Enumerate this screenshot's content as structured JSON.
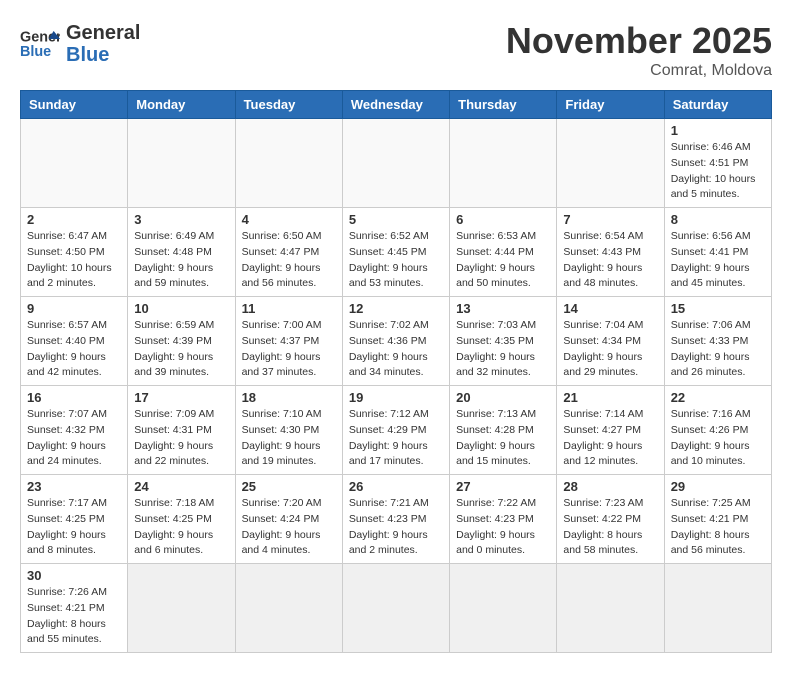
{
  "header": {
    "logo_general": "General",
    "logo_blue": "Blue",
    "month_title": "November 2025",
    "location": "Comrat, Moldova"
  },
  "weekdays": [
    "Sunday",
    "Monday",
    "Tuesday",
    "Wednesday",
    "Thursday",
    "Friday",
    "Saturday"
  ],
  "weeks": [
    [
      {
        "day": "",
        "info": ""
      },
      {
        "day": "",
        "info": ""
      },
      {
        "day": "",
        "info": ""
      },
      {
        "day": "",
        "info": ""
      },
      {
        "day": "",
        "info": ""
      },
      {
        "day": "",
        "info": ""
      },
      {
        "day": "1",
        "info": "Sunrise: 6:46 AM\nSunset: 4:51 PM\nDaylight: 10 hours and 5 minutes."
      }
    ],
    [
      {
        "day": "2",
        "info": "Sunrise: 6:47 AM\nSunset: 4:50 PM\nDaylight: 10 hours and 2 minutes."
      },
      {
        "day": "3",
        "info": "Sunrise: 6:49 AM\nSunset: 4:48 PM\nDaylight: 9 hours and 59 minutes."
      },
      {
        "day": "4",
        "info": "Sunrise: 6:50 AM\nSunset: 4:47 PM\nDaylight: 9 hours and 56 minutes."
      },
      {
        "day": "5",
        "info": "Sunrise: 6:52 AM\nSunset: 4:45 PM\nDaylight: 9 hours and 53 minutes."
      },
      {
        "day": "6",
        "info": "Sunrise: 6:53 AM\nSunset: 4:44 PM\nDaylight: 9 hours and 50 minutes."
      },
      {
        "day": "7",
        "info": "Sunrise: 6:54 AM\nSunset: 4:43 PM\nDaylight: 9 hours and 48 minutes."
      },
      {
        "day": "8",
        "info": "Sunrise: 6:56 AM\nSunset: 4:41 PM\nDaylight: 9 hours and 45 minutes."
      }
    ],
    [
      {
        "day": "9",
        "info": "Sunrise: 6:57 AM\nSunset: 4:40 PM\nDaylight: 9 hours and 42 minutes."
      },
      {
        "day": "10",
        "info": "Sunrise: 6:59 AM\nSunset: 4:39 PM\nDaylight: 9 hours and 39 minutes."
      },
      {
        "day": "11",
        "info": "Sunrise: 7:00 AM\nSunset: 4:37 PM\nDaylight: 9 hours and 37 minutes."
      },
      {
        "day": "12",
        "info": "Sunrise: 7:02 AM\nSunset: 4:36 PM\nDaylight: 9 hours and 34 minutes."
      },
      {
        "day": "13",
        "info": "Sunrise: 7:03 AM\nSunset: 4:35 PM\nDaylight: 9 hours and 32 minutes."
      },
      {
        "day": "14",
        "info": "Sunrise: 7:04 AM\nSunset: 4:34 PM\nDaylight: 9 hours and 29 minutes."
      },
      {
        "day": "15",
        "info": "Sunrise: 7:06 AM\nSunset: 4:33 PM\nDaylight: 9 hours and 26 minutes."
      }
    ],
    [
      {
        "day": "16",
        "info": "Sunrise: 7:07 AM\nSunset: 4:32 PM\nDaylight: 9 hours and 24 minutes."
      },
      {
        "day": "17",
        "info": "Sunrise: 7:09 AM\nSunset: 4:31 PM\nDaylight: 9 hours and 22 minutes."
      },
      {
        "day": "18",
        "info": "Sunrise: 7:10 AM\nSunset: 4:30 PM\nDaylight: 9 hours and 19 minutes."
      },
      {
        "day": "19",
        "info": "Sunrise: 7:12 AM\nSunset: 4:29 PM\nDaylight: 9 hours and 17 minutes."
      },
      {
        "day": "20",
        "info": "Sunrise: 7:13 AM\nSunset: 4:28 PM\nDaylight: 9 hours and 15 minutes."
      },
      {
        "day": "21",
        "info": "Sunrise: 7:14 AM\nSunset: 4:27 PM\nDaylight: 9 hours and 12 minutes."
      },
      {
        "day": "22",
        "info": "Sunrise: 7:16 AM\nSunset: 4:26 PM\nDaylight: 9 hours and 10 minutes."
      }
    ],
    [
      {
        "day": "23",
        "info": "Sunrise: 7:17 AM\nSunset: 4:25 PM\nDaylight: 9 hours and 8 minutes."
      },
      {
        "day": "24",
        "info": "Sunrise: 7:18 AM\nSunset: 4:25 PM\nDaylight: 9 hours and 6 minutes."
      },
      {
        "day": "25",
        "info": "Sunrise: 7:20 AM\nSunset: 4:24 PM\nDaylight: 9 hours and 4 minutes."
      },
      {
        "day": "26",
        "info": "Sunrise: 7:21 AM\nSunset: 4:23 PM\nDaylight: 9 hours and 2 minutes."
      },
      {
        "day": "27",
        "info": "Sunrise: 7:22 AM\nSunset: 4:23 PM\nDaylight: 9 hours and 0 minutes."
      },
      {
        "day": "28",
        "info": "Sunrise: 7:23 AM\nSunset: 4:22 PM\nDaylight: 8 hours and 58 minutes."
      },
      {
        "day": "29",
        "info": "Sunrise: 7:25 AM\nSunset: 4:21 PM\nDaylight: 8 hours and 56 minutes."
      }
    ],
    [
      {
        "day": "30",
        "info": "Sunrise: 7:26 AM\nSunset: 4:21 PM\nDaylight: 8 hours and 55 minutes."
      },
      {
        "day": "",
        "info": ""
      },
      {
        "day": "",
        "info": ""
      },
      {
        "day": "",
        "info": ""
      },
      {
        "day": "",
        "info": ""
      },
      {
        "day": "",
        "info": ""
      },
      {
        "day": "",
        "info": ""
      }
    ]
  ]
}
